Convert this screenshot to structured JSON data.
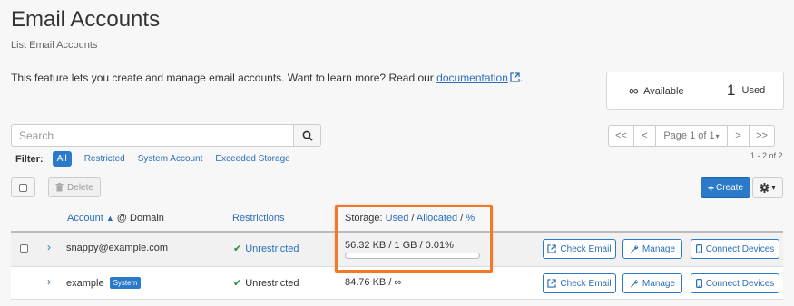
{
  "page": {
    "title": "Email Accounts",
    "subtitle": "List Email Accounts",
    "intro_text": "This feature lets you create and manage email accounts. Want to learn more? Read our ",
    "doc_link": "documentation",
    "intro_end": "."
  },
  "stats": {
    "available_symbol": "∞",
    "available_label": "Available",
    "used_count": "1",
    "used_label": "Used"
  },
  "search": {
    "placeholder": "Search"
  },
  "filters": {
    "label": "Filter:",
    "items": [
      "All",
      "Restricted",
      "System Account",
      "Exceeded Storage"
    ],
    "active": "All"
  },
  "pager": {
    "first": "<<",
    "prev": "<",
    "page_label": "Page 1 of 1",
    "next": ">",
    "last": ">>",
    "range": "1 - 2 of 2"
  },
  "toolbar": {
    "delete_label": "Delete",
    "create_label": "Create"
  },
  "table": {
    "headers": {
      "account": "Account",
      "at_domain": "@ Domain",
      "restrictions": "Restrictions",
      "storage_prefix": "Storage:",
      "used": "Used",
      "allocated": "Allocated",
      "percent": "%"
    },
    "rows": [
      {
        "account": "snappy@example.com",
        "restriction": "Unrestricted",
        "storage": "56.32 KB / 1 GB / 0.01%",
        "usage_fraction": 0.0001,
        "system": false,
        "actions": [
          "Check Email",
          "Manage",
          "Connect Devices"
        ]
      },
      {
        "account": "example",
        "badge": "System",
        "restriction": "Unrestricted",
        "storage": "84.76 KB / ∞",
        "system": true,
        "actions": [
          "Check Email",
          "Manage",
          "Connect Devices"
        ]
      }
    ]
  },
  "colors": {
    "accent": "#2a7ac9",
    "highlight": "#f07a2a",
    "success": "#2e8b3a"
  }
}
